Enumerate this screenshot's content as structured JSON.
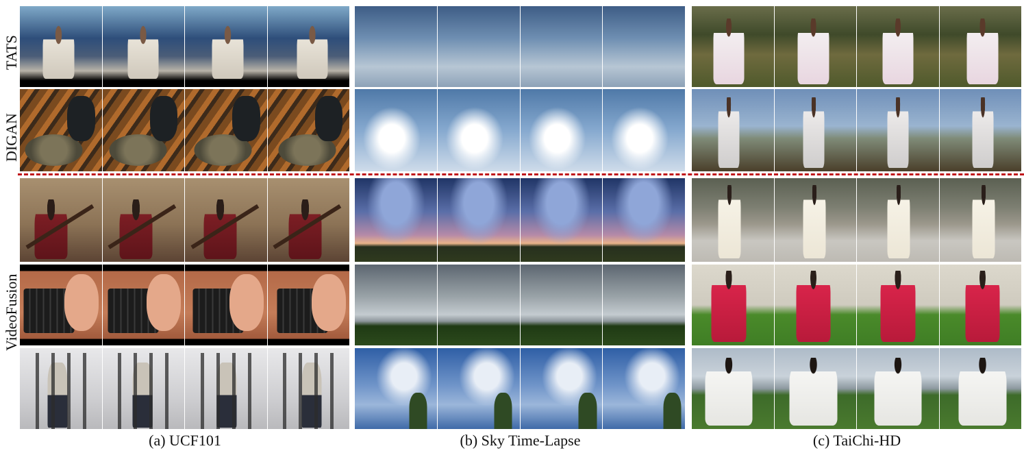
{
  "row_labels": {
    "tats": "TATS",
    "digan": "DIGAN",
    "videofusion": "VideoFusion"
  },
  "captions": {
    "ucf101": "(a) UCF101",
    "sky": "(b) Sky Time-Lapse",
    "taichi": "(c) TaiChi-HD"
  },
  "colors": {
    "divider": "#c0171b"
  },
  "datasets": [
    {
      "key": "ucf101",
      "rows": [
        {
          "method": "TATS",
          "scene": "sitar player in front of blue banners"
        },
        {
          "method": "DIGAN",
          "scene": "drum player with striped background"
        },
        {
          "method": "VideoFusion",
          "scene": "person playing sitar"
        },
        {
          "method": "VideoFusion",
          "scene": "hands typing on keyboard"
        },
        {
          "method": "VideoFusion",
          "scene": "man doing pull-ups in gym rack"
        }
      ]
    },
    {
      "key": "sky",
      "rows": [
        {
          "method": "TATS",
          "scene": "overcast sky"
        },
        {
          "method": "DIGAN",
          "scene": "cloudy blue sky"
        },
        {
          "method": "VideoFusion",
          "scene": "sunset sky over field"
        },
        {
          "method": "VideoFusion",
          "scene": "grey clouds over trees"
        },
        {
          "method": "VideoFusion",
          "scene": "blue sky with trees"
        }
      ]
    },
    {
      "key": "taichi",
      "rows": [
        {
          "method": "TATS",
          "scene": "person in white on grass"
        },
        {
          "method": "DIGAN",
          "scene": "person in white by lake"
        },
        {
          "method": "VideoFusion",
          "scene": "person in white by rocks"
        },
        {
          "method": "VideoFusion",
          "scene": "person in red on lawn"
        },
        {
          "method": "VideoFusion",
          "scene": "woman in white by sea"
        }
      ]
    }
  ]
}
